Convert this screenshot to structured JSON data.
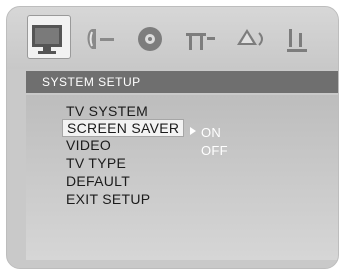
{
  "top_icons": [
    "monitor-setup-icon",
    "audio-setup-icon",
    "video-setup-icon",
    "preference-setup-icon",
    "speaker-setup-icon",
    "equalizer-setup-icon"
  ],
  "title": "SYSTEM SETUP",
  "menu_items": [
    "TV SYSTEM",
    "SCREEN SAVER",
    "VIDEO",
    "TV TYPE",
    "DEFAULT",
    "EXIT SETUP"
  ],
  "selected_item": "SCREEN SAVER",
  "options": [
    "ON",
    "OFF"
  ],
  "colors": {
    "title_bg": "#6f6f6f",
    "panel_bg": "#c9c9c9",
    "text": "#1b1b1b",
    "highlight": "#f3f3f3"
  }
}
